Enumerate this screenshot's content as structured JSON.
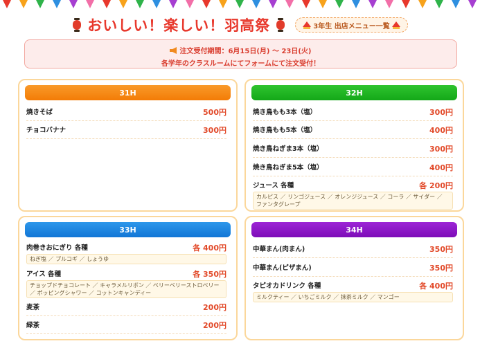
{
  "header": {
    "title": "おいしい！楽しい！羽高祭",
    "badge": "3年生 出店メニュー一覧"
  },
  "notice": {
    "line1": "注文受付期間：6月15日(月) ～ 23日(火)",
    "line2": "各学年のクラスルームにてフォームにて注文受付！"
  },
  "colors": {
    "c31": "#f7870c",
    "c32": "#1bb51f",
    "c33": "#1b84e0",
    "c34": "#8a12c4",
    "price": "#e24a2a",
    "title": "#e8382c"
  },
  "cards": [
    {
      "name": "31H",
      "items": [
        {
          "name": "焼きそば",
          "price": "500円"
        },
        {
          "name": "チョコバナナ",
          "price": "300円"
        }
      ]
    },
    {
      "name": "32H",
      "items": [
        {
          "name": "焼き鳥もも3本（塩）",
          "price": "300円"
        },
        {
          "name": "焼き鳥もも5本（塩）",
          "price": "400円"
        },
        {
          "name": "焼き鳥ねぎま3本（塩）",
          "price": "300円"
        },
        {
          "name": "焼き鳥ねぎま5本（塩）",
          "price": "400円"
        },
        {
          "name": "ジュース 各種",
          "price": "各 200円",
          "options": "カルピス ／ リンゴジュース ／ オレンジジュース ／ コーラ ／ サイダー ／ ファンタグレープ"
        }
      ]
    },
    {
      "name": "33H",
      "items": [
        {
          "name": "肉巻きおにぎり 各種",
          "price": "各 400円",
          "options": "ねぎ塩 ／ プルコギ ／ しょうゆ"
        },
        {
          "name": "アイス 各種",
          "price": "各 350円",
          "options": "チョップドチョコレート ／ キャラメルリボン ／ ベリーベリーストロベリー ／ ポッピングシャワー ／ コットンキャンディー"
        },
        {
          "name": "麦茶",
          "price": "200円"
        },
        {
          "name": "緑茶",
          "price": "200円"
        }
      ]
    },
    {
      "name": "34H",
      "items": [
        {
          "name": "中華まん(肉まん)",
          "price": "350円"
        },
        {
          "name": "中華まん(ピザまん)",
          "price": "350円"
        },
        {
          "name": "タピオカドリンク 各種",
          "price": "各 400円",
          "options": "ミルクティー ／ いちごミルク ／ 抹茶ミルク ／ マンゴー"
        }
      ]
    }
  ]
}
